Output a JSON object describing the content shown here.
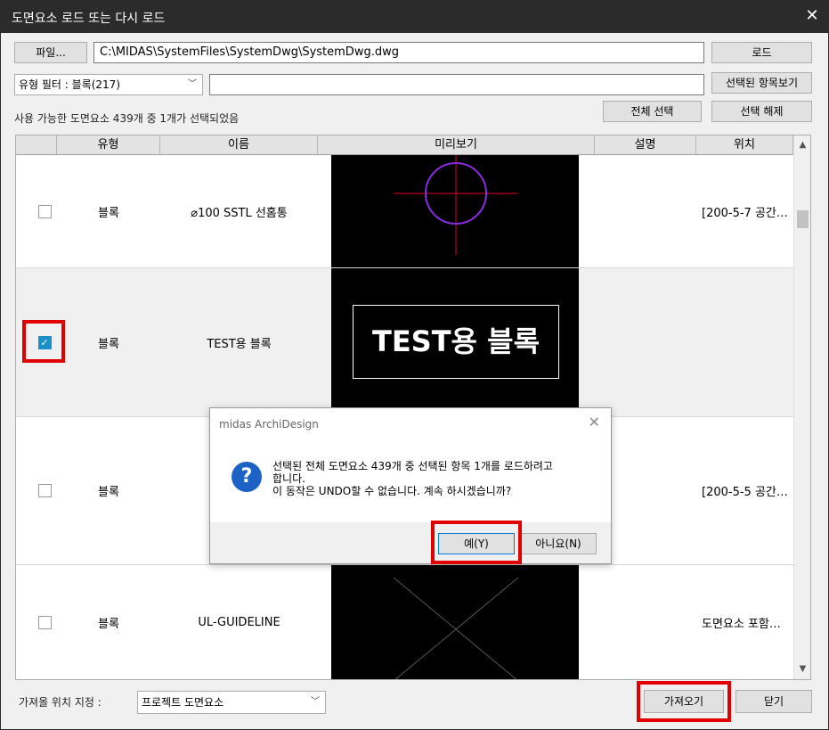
{
  "window": {
    "title": "도면요소 로드 또는 다시 로드",
    "close": "✕"
  },
  "toolbar": {
    "file_button": "파일...",
    "path_value": "C:\\MIDAS\\SystemFiles\\SystemDwg\\SystemDwg.dwg",
    "load_button": "로드",
    "filter_value": "유형 필터 : 블록(217)",
    "filter_text": "",
    "view_selected_button": "선택된 항목보기",
    "select_all_button": "전체 선택",
    "deselect_button": "선택 해제"
  },
  "status": "사용 가능한 도면요소 439개 중 1개가 선택되었음",
  "table": {
    "headers": [
      "유형",
      "이름",
      "미리보기",
      "설명",
      "위치"
    ],
    "rows": [
      {
        "checked": false,
        "type": "블록",
        "name": "⌀100 SSTL 선홈통",
        "desc": "",
        "location": "[200-5-7 공간…"
      },
      {
        "checked": true,
        "type": "블록",
        "name": "TEST용 블록",
        "desc": "",
        "location": "",
        "preview_text": "TEST용 블록"
      },
      {
        "checked": false,
        "type": "블록",
        "name": "",
        "desc": "",
        "location": "[200-5-5 공간…"
      },
      {
        "checked": false,
        "type": "블록",
        "name": "UL-GUIDELINE",
        "desc": "",
        "location": "도면요소 포함…"
      }
    ]
  },
  "bottom": {
    "dest_label": "가져올 위치 지정 :",
    "dest_value": "프로젝트 도면요소",
    "import_button": "가져오기",
    "close_button": "닫기"
  },
  "dialog": {
    "title": "midas ArchiDesign",
    "close": "✕",
    "icon": "?",
    "message_line1": "선택된 전체 도면요소 439개 중 선택된 항목 1개를 로드하려고",
    "message_line2": "합니다.",
    "message_line3": "이 동작은 UNDO할 수 없습니다. 계속 하시겠습니까?",
    "yes_button": "예(Y)",
    "no_button": "아니요(N)"
  },
  "colors": {
    "highlight": "#e00000",
    "dialog_icon": "#1c62c4",
    "checkbox_on": "#1a8fc8"
  }
}
